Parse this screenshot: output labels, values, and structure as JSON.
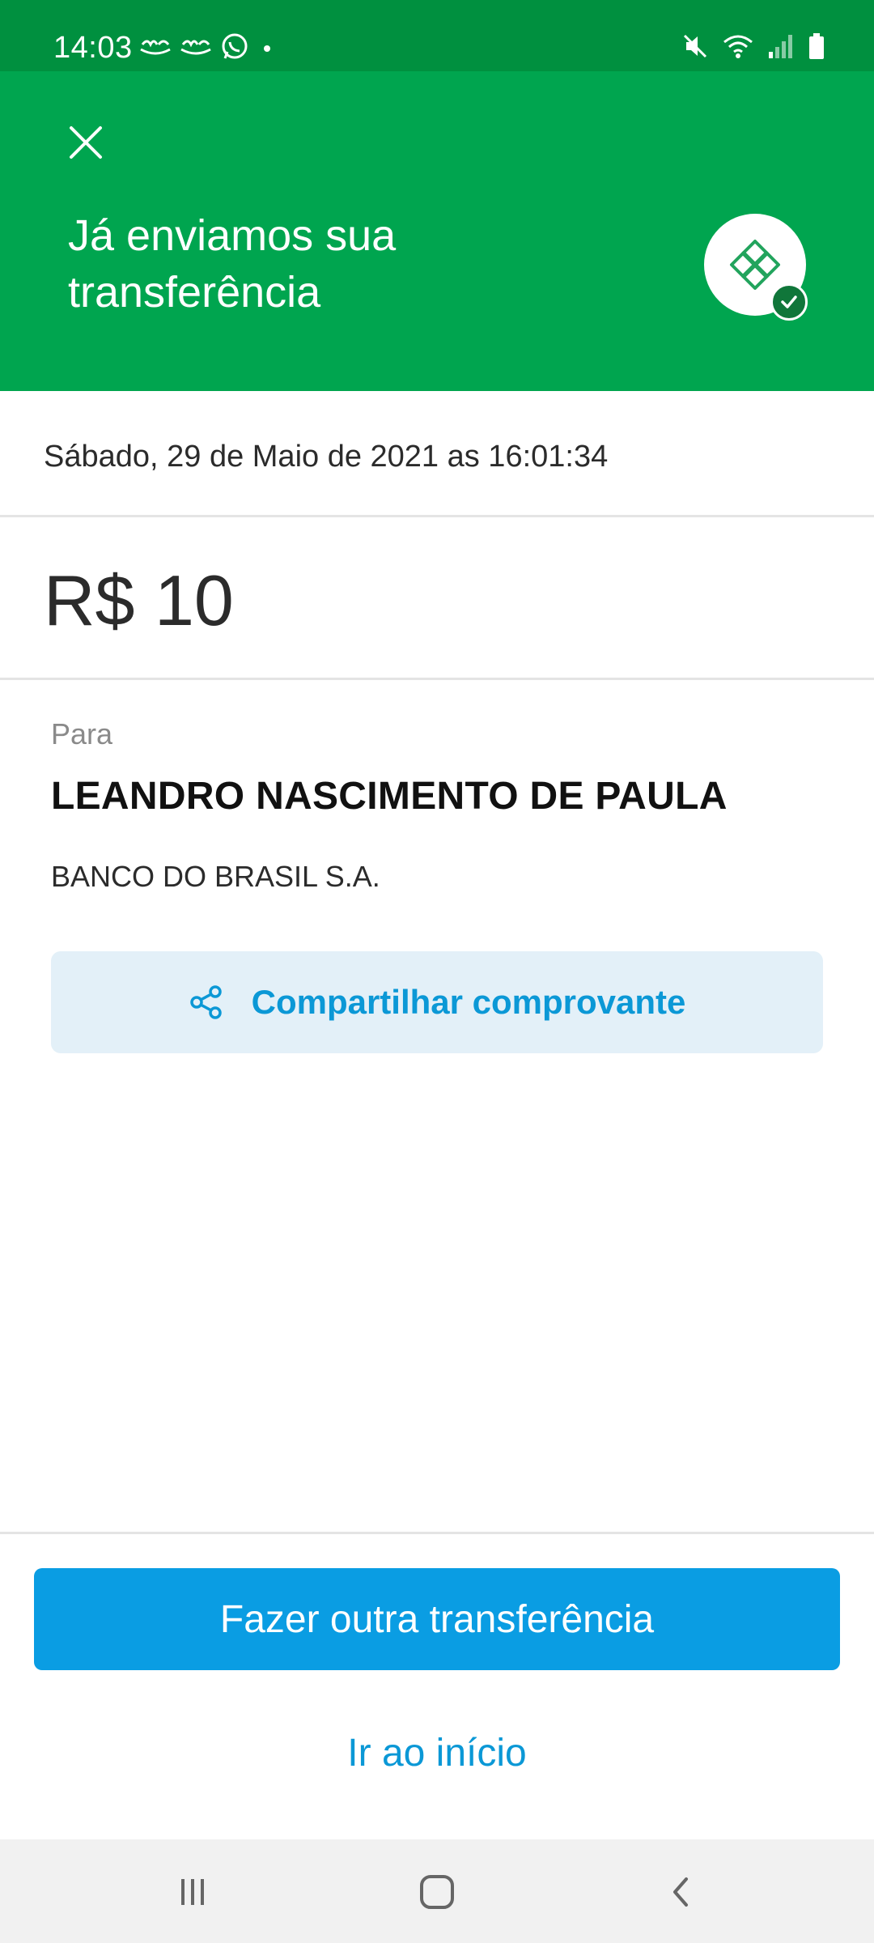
{
  "status_bar": {
    "time": "14:03",
    "icons_left": [
      "app-notification-icon",
      "app-notification-icon",
      "whatsapp-icon",
      "dot-icon"
    ],
    "icons_right": [
      "mute-icon",
      "wifi-icon",
      "signal-icon",
      "battery-icon"
    ]
  },
  "header": {
    "title": "Já enviamos sua transferência",
    "background": "#00a54f",
    "badge_icon": "pix-icon",
    "check_icon": "check-icon"
  },
  "receipt": {
    "date": "Sábado, 29 de Maio de 2021 as 16:01:34",
    "amount": "R$ 10",
    "to_label": "Para",
    "recipient_name": "LEANDRO NASCIMENTO DE PAULA",
    "bank": "BANCO DO BRASIL S.A."
  },
  "actions": {
    "share_label": "Compartilhar comprovante",
    "share_icon": "share-icon",
    "primary_label": "Fazer outra transferência",
    "secondary_label": "Ir ao início",
    "accent": "#0a9de3"
  },
  "nav": {
    "items": [
      "recent-apps-icon",
      "home-icon",
      "back-icon"
    ]
  }
}
